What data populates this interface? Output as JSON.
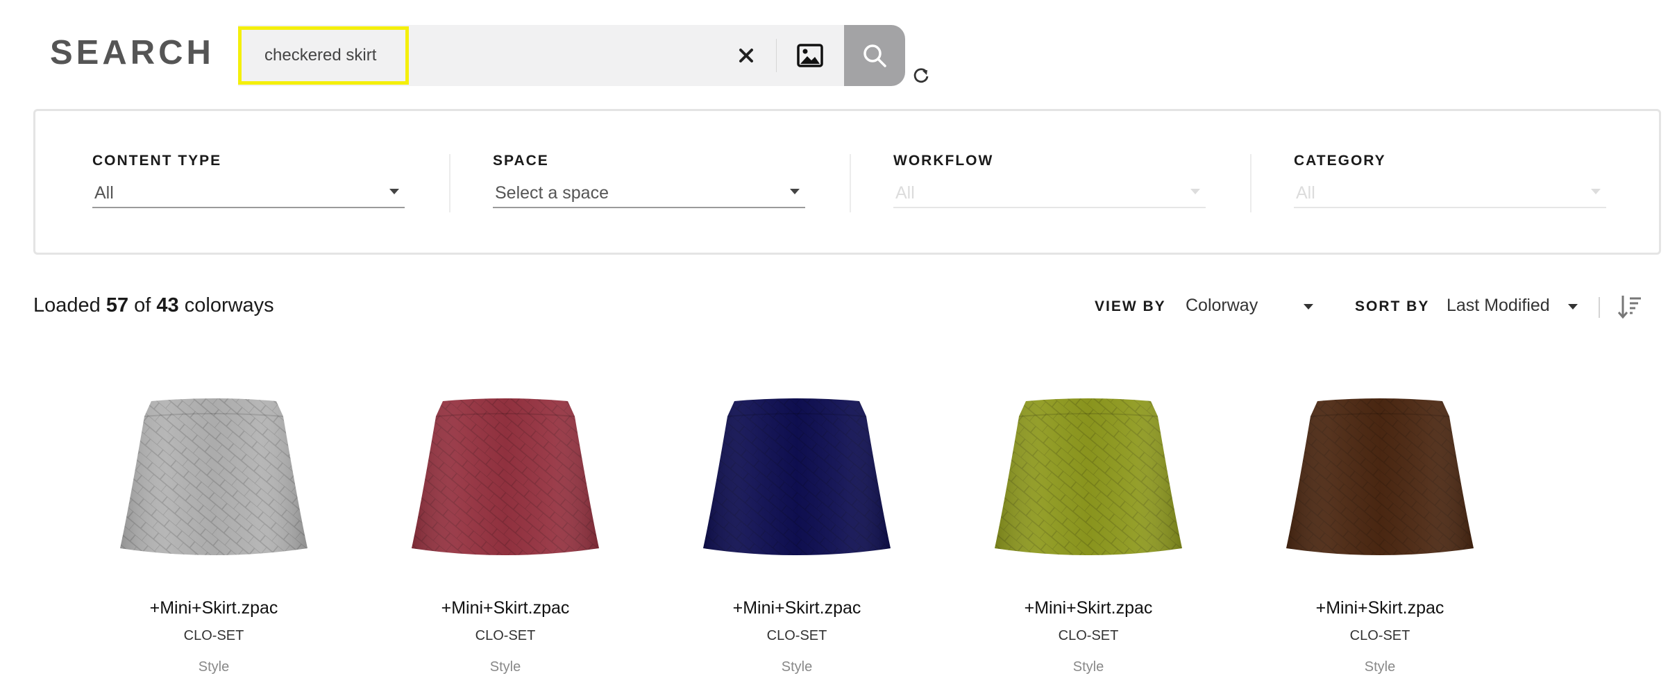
{
  "header": {
    "title": "SEARCH"
  },
  "search": {
    "query": "checkered skirt",
    "placeholder": ""
  },
  "filters": [
    {
      "label": "CONTENT TYPE",
      "value": "All",
      "disabled": false
    },
    {
      "label": "SPACE",
      "value": "Select a space",
      "disabled": false
    },
    {
      "label": "WORKFLOW",
      "value": "All",
      "disabled": true
    },
    {
      "label": "CATEGORY",
      "value": "All",
      "disabled": true
    }
  ],
  "results": {
    "prefix": "Loaded",
    "loaded": "57",
    "of": "of",
    "total": "43",
    "unit": "colorways"
  },
  "toolbar": {
    "view_by_label": "VIEW BY",
    "view_by_value": "Colorway",
    "sort_by_label": "SORT BY",
    "sort_by_value": "Last Modified"
  },
  "icons": {
    "clear": "close-icon",
    "image_search": "image-icon",
    "search": "search-icon",
    "refresh": "refresh-icon",
    "sort_order": "sort-descending-icon"
  },
  "items": [
    {
      "name": "+Mini+Skirt.zpac",
      "source": "CLO-SET",
      "type": "Style",
      "color": "#b3b3b3"
    },
    {
      "name": "+Mini+Skirt.zpac",
      "source": "CLO-SET",
      "type": "Style",
      "color": "#963341"
    },
    {
      "name": "+Mini+Skirt.zpac",
      "source": "CLO-SET",
      "type": "Style",
      "color": "#0f0f52"
    },
    {
      "name": "+Mini+Skirt.zpac",
      "source": "CLO-SET",
      "type": "Style",
      "color": "#8f9a1f"
    },
    {
      "name": "+Mini+Skirt.zpac",
      "source": "CLO-SET",
      "type": "Style",
      "color": "#4c2812"
    }
  ],
  "colors": {
    "highlight": "#f4ef0c",
    "search_button": "#a3a3a5",
    "search_bar": "#f1f1f2"
  }
}
